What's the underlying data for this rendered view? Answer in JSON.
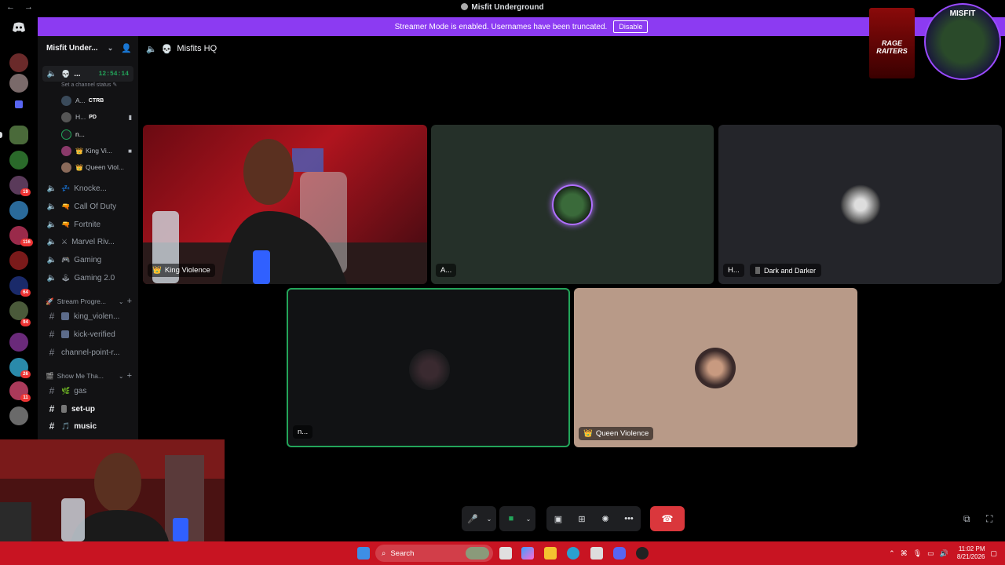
{
  "window": {
    "title": "Misfit Underground",
    "back_icon": "arrow-left-icon",
    "forward_icon": "arrow-right-icon"
  },
  "banner": {
    "message": "Streamer Mode is enabled. Usernames have been truncated.",
    "disable_label": "Disable",
    "color": "#8c3bf2"
  },
  "server_rail": {
    "badges": [
      "19",
      "116",
      "64",
      "94",
      "26",
      "11"
    ]
  },
  "sidebar": {
    "guild_name": "Misfit Under...",
    "active_channel": {
      "emoji": "💀",
      "name": "...",
      "timer": "12:54:14",
      "status_hint": "Set a channel status"
    },
    "members": [
      {
        "name": "A...",
        "tag": "CTRB",
        "color": "#3a4a5a"
      },
      {
        "name": "H...",
        "tag": "PD",
        "color": "#555"
      },
      {
        "name": "n...",
        "tag": "",
        "color": "#1e1f22"
      },
      {
        "name": "King Vi...",
        "tag": "",
        "color": "#8a3a3a"
      },
      {
        "name": "Queen Viol...",
        "tag": "",
        "color": "#8a6a5a"
      }
    ],
    "voice_channels": [
      {
        "emoji": "💤",
        "name": "Knocke..."
      },
      {
        "emoji": "🔫",
        "name": "Call Of Duty"
      },
      {
        "emoji": "🔫",
        "name": "Fortnite"
      },
      {
        "emoji": "⚔",
        "name": "Marvel Riv..."
      },
      {
        "emoji": "🎮",
        "name": "Gaming"
      },
      {
        "emoji": "🕹",
        "name": "Gaming 2.0"
      }
    ],
    "category_stream": "Stream Progre...",
    "stream_channels": [
      {
        "name": "king_violen...",
        "bright": false
      },
      {
        "name": "kick-verified",
        "bright": false
      },
      {
        "name": "channel-point-r...",
        "bright": false
      }
    ],
    "category_show": "Show Me Tha...",
    "show_channels": [
      {
        "emoji": "🌿",
        "name": "gas",
        "bright": false
      },
      {
        "emoji": "",
        "name": "set-up",
        "bright": true
      },
      {
        "emoji": "🎵",
        "name": "music",
        "bright": true
      }
    ]
  },
  "call": {
    "channel_title": "Misfits HQ",
    "tiles": [
      {
        "name": "King Violence",
        "has_crown": true
      },
      {
        "name": "A..."
      },
      {
        "name": "H...",
        "activity": "Dark and Darker"
      },
      {
        "name": "n..."
      },
      {
        "name": "Queen Violence",
        "has_crown": true
      }
    ],
    "controls": [
      "microphone-icon",
      "camera-icon",
      "screen-share-icon",
      "activities-icon",
      "soundboard-icon",
      "more-icon",
      "hang-up-icon"
    ]
  },
  "overlay": {
    "logo_text": "MISFIT",
    "rage_text": "RAGE RAITERS"
  },
  "taskbar": {
    "search_label": "Search",
    "time": "11:02 PM",
    "date": "8/21/2026",
    "color": "#c81422"
  }
}
